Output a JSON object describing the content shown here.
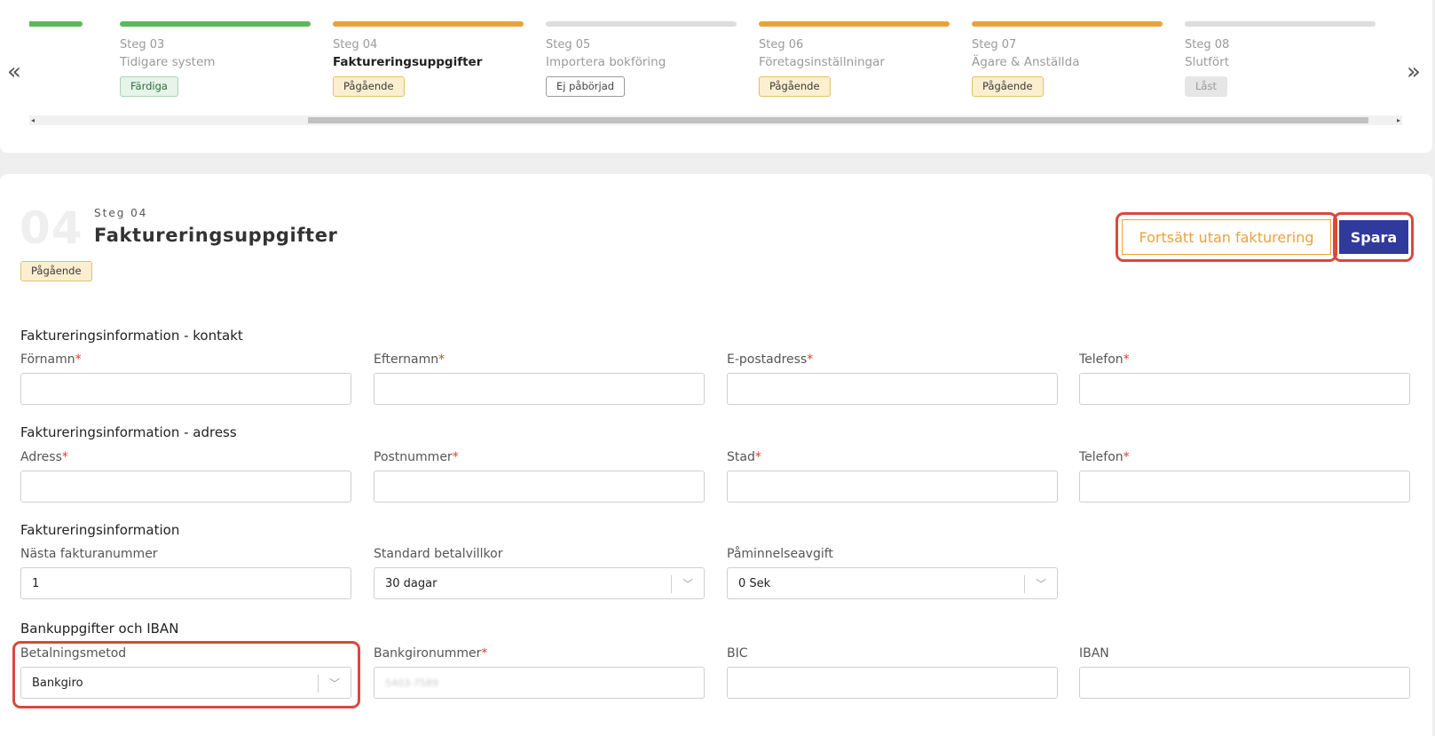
{
  "stepper": {
    "prev_label": "«",
    "next_label": "»",
    "steps": [
      {
        "num": "",
        "title": "",
        "status": "",
        "bar_color": "#5cb85c"
      },
      {
        "num": "Steg 03",
        "title": "Tidigare system",
        "status": "Färdiga",
        "bar_color": "#5cb85c"
      },
      {
        "num": "Steg 04",
        "title": "Faktureringsuppgifter",
        "status": "Pågående",
        "bar_color": "#e9a23b"
      },
      {
        "num": "Steg 05",
        "title": "Importera bokföring",
        "status": "Ej påbörjad",
        "bar_color": "#dddddd"
      },
      {
        "num": "Steg 06",
        "title": "Företagsinställningar",
        "status": "Pågående",
        "bar_color": "#e9a23b"
      },
      {
        "num": "Steg 07",
        "title": "Ägare & Anställda",
        "status": "Pågående",
        "bar_color": "#e9a23b"
      },
      {
        "num": "Steg 08",
        "title": "Slutfört",
        "status": "Låst",
        "bar_color": "#dddddd"
      }
    ]
  },
  "page": {
    "big_number": "04",
    "step_label": "Steg 04",
    "title": "Faktureringsuppgifter",
    "status": "Pågående",
    "continue_button": "Fortsätt utan fakturering",
    "save_button": "Spara"
  },
  "sections": {
    "contact": {
      "title": "Faktureringsinformation - kontakt",
      "first_name": "Förnamn",
      "last_name": "Efternamn",
      "email": "E-postadress",
      "phone": "Telefon"
    },
    "address": {
      "title": "Faktureringsinformation - adress",
      "address": "Adress",
      "postal_code": "Postnummer",
      "city": "Stad",
      "phone": "Telefon"
    },
    "invoicing": {
      "title": "Faktureringsinformation",
      "next_invoice_label": "Nästa fakturanummer",
      "next_invoice_value": "1",
      "payment_terms_label": "Standard betalvillkor",
      "payment_terms_value": "30 dagar",
      "reminder_fee_label": "Påminnelseavgift",
      "reminder_fee_value": "0 Sek"
    },
    "bank": {
      "title": "Bankuppgifter och IBAN",
      "payment_method_label": "Betalningsmetod",
      "payment_method_value": "Bankgiro",
      "bankgiro_label": "Bankgironummer",
      "bankgiro_value": "5403-7589",
      "bic_label": "BIC",
      "iban_label": "IBAN"
    }
  },
  "required_marker": "*",
  "colors": {
    "accent_orange": "#e9a23b",
    "primary_blue": "#2f3a9c",
    "highlight_red": "#d9493c",
    "done_green": "#5cb85c"
  }
}
